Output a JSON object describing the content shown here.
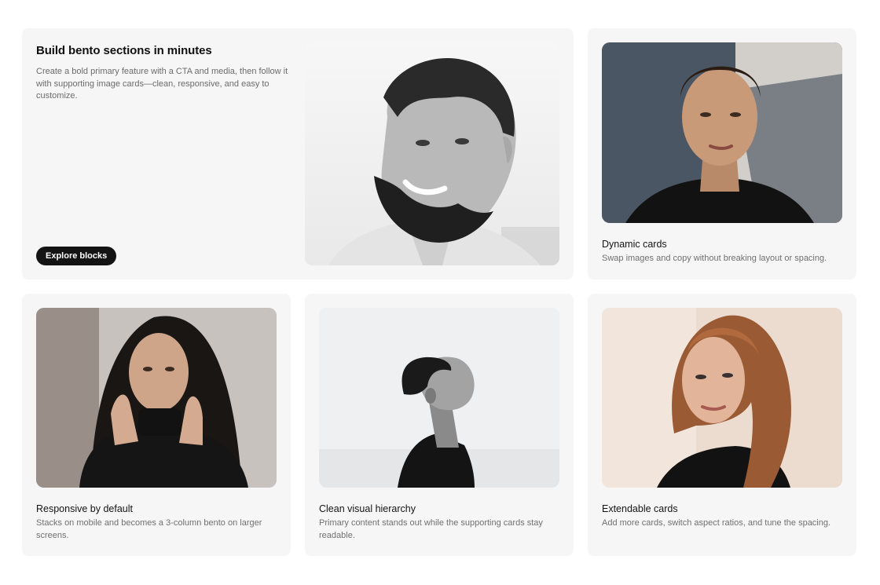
{
  "hero": {
    "title": "Build bento sections in minutes",
    "description": "Create a bold primary feature with a CTA and media, then follow it with supporting image cards—clean, responsive, and easy to customize.",
    "cta_label": "Explore blocks"
  },
  "cards": [
    {
      "title": "Dynamic cards",
      "description": "Swap images and copy without breaking layout or spacing."
    },
    {
      "title": "Responsive by default",
      "description": "Stacks on mobile and becomes a 3-column bento on larger screens."
    },
    {
      "title": "Clean visual hierarchy",
      "description": "Primary content stands out while the supporting cards stay readable."
    },
    {
      "title": "Extendable cards",
      "description": "Add more cards, switch aspect ratios, and tune the spacing."
    }
  ],
  "colors": {
    "card_bg": "#f6f6f6",
    "cta_bg": "#141414",
    "cta_text": "#ffffff"
  }
}
